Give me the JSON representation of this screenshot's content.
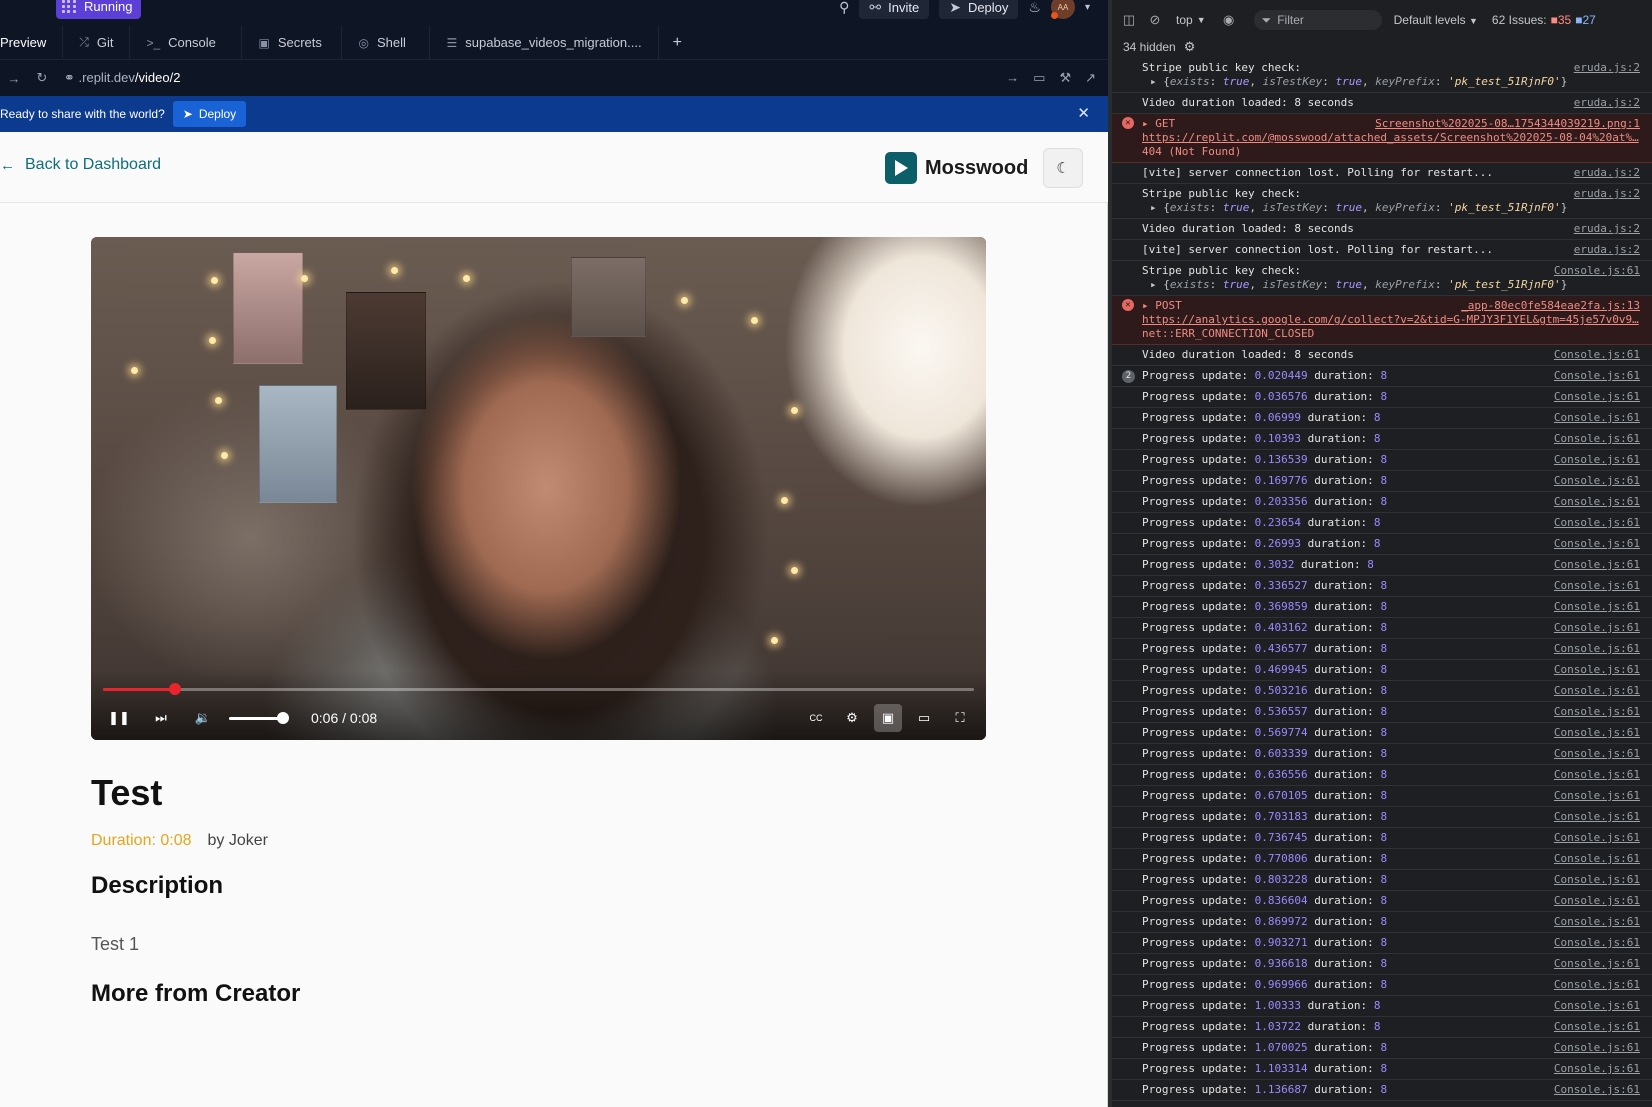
{
  "topbar": {
    "running_label": "Running",
    "invite_label": "Invite",
    "deploy_label": "Deploy",
    "avatar_initials": "AA"
  },
  "tabs": [
    {
      "label": "Preview"
    },
    {
      "label": "Git"
    },
    {
      "label": "Console"
    },
    {
      "label": "Secrets"
    },
    {
      "label": "Shell"
    },
    {
      "label": "supabase_videos_migration...."
    }
  ],
  "urlbar": {
    "host": ".replit.dev",
    "path": "/video/2"
  },
  "banner": {
    "message": "Ready to share with the world?",
    "button": "Deploy"
  },
  "app": {
    "back_label": "Back to Dashboard",
    "brand": "Mosswood",
    "player": {
      "time": "0:06 / 0:08",
      "progress": 0.0826,
      "volume": 0.9
    },
    "title": "Test",
    "duration": "Duration: 0:08",
    "author": "by Joker",
    "description_heading": "Description",
    "description": "Test 1",
    "more_heading": "More from Creator"
  },
  "devtools": {
    "context": "top",
    "filter_placeholder": "Filter",
    "levels": "Default levels",
    "issues_label": "62 Issues:",
    "issues_errors": "35",
    "issues_warnings": "27",
    "hidden": "34 hidden",
    "colors": {
      "error": "#f28b82",
      "number": "#9b8aff"
    },
    "log": [
      {
        "type": "obj",
        "text": "Stripe public key check:",
        "src": "eruda.js:2",
        "sub": [
          "exists",
          "true",
          "isTestKey",
          "true",
          "keyPrefix",
          "'pk_test_51RjnF0'"
        ]
      },
      {
        "type": "plain",
        "text": "Video duration loaded: 8 seconds",
        "src": "eruda.js:2"
      },
      {
        "type": "err3",
        "method": "GET",
        "src": "Screenshot%202025-08…1754344039219.png:1",
        "line2": "https://replit.com/@mosswood/attached_assets/Screenshot%202025-08-04%20at%…",
        "line3": "404 (Not Found)"
      },
      {
        "type": "plain",
        "text": "[vite] server connection lost. Polling for restart...",
        "src": "eruda.js:2"
      },
      {
        "type": "obj",
        "text": "Stripe public key check:",
        "src": "eruda.js:2",
        "sub": [
          "exists",
          "true",
          "isTestKey",
          "true",
          "keyPrefix",
          "'pk_test_51RjnF0'"
        ]
      },
      {
        "type": "plain",
        "text": "Video duration loaded: 8 seconds",
        "src": "eruda.js:2"
      },
      {
        "type": "plain",
        "text": "[vite] server connection lost. Polling for restart...",
        "src": "eruda.js:2"
      },
      {
        "type": "obj",
        "text": "Stripe public key check:",
        "src": "Console.js:61",
        "sub": [
          "exists",
          "true",
          "isTestKey",
          "true",
          "keyPrefix",
          "'pk_test_51RjnF0'"
        ]
      },
      {
        "type": "err3",
        "method": "POST",
        "src": "_app-80ec0fe584eae2fa.js:13",
        "line2": "https://analytics.google.com/g/collect?v=2&tid=G-MPJY3F1YEL&gtm=45je57v0v9…",
        "line3": "net::ERR_CONNECTION_CLOSED"
      },
      {
        "type": "plain",
        "text": "Video duration loaded: 8 seconds",
        "src": "Console.js:61"
      }
    ],
    "progress_first_badge": "2",
    "progress_values": [
      "0.020449",
      "0.036576",
      "0.06999",
      "0.10393",
      "0.136539",
      "0.169776",
      "0.203356",
      "0.23654",
      "0.26993",
      "0.3032",
      "0.336527",
      "0.369859",
      "0.403162",
      "0.436577",
      "0.469945",
      "0.503216",
      "0.536557",
      "0.569774",
      "0.603339",
      "0.636556",
      "0.670105",
      "0.703183",
      "0.736745",
      "0.770806",
      "0.803228",
      "0.836604",
      "0.869972",
      "0.903271",
      "0.936618",
      "0.969966",
      "1.00333",
      "1.03722",
      "1.070025",
      "1.103314",
      "1.136687"
    ],
    "progress_prefix": "Progress update:",
    "progress_duration": "duration:",
    "progress_duration_value": "8",
    "progress_src": "Console.js:61"
  }
}
